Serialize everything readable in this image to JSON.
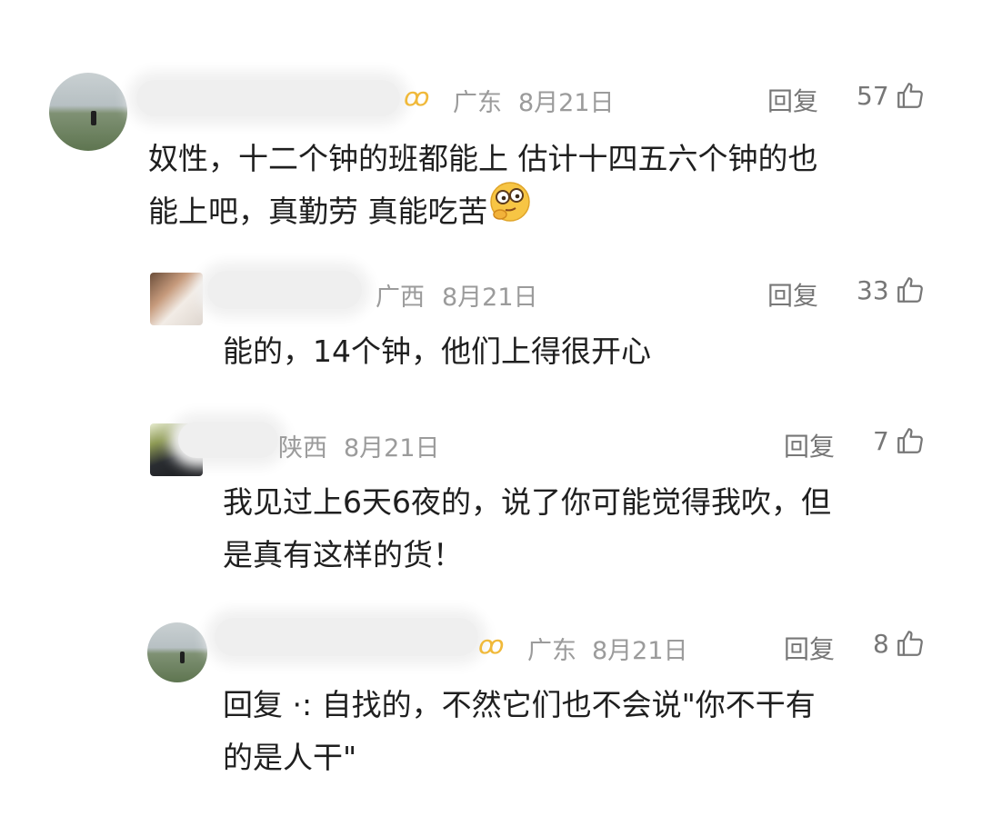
{
  "comments": [
    {
      "region": "广东",
      "date": "8月21日",
      "reply_label": "回复",
      "likes": "57",
      "text_line1": "奴性，十二个钟的班都能上 估计十四五六个钟的也",
      "text_line2": "能上吧，真勤劳 真能吃苦",
      "emoji": "thinking-glasses-emoji"
    },
    {
      "region": "广西",
      "date": "8月21日",
      "reply_label": "回复",
      "likes": "33",
      "text_line1": "能的，14个钟，他们上得很开心"
    },
    {
      "region": "陕西",
      "date": "8月21日",
      "reply_label": "回复",
      "likes": "7",
      "text_line1": "我见过上6天6夜的，说了你可能觉得我吹，但",
      "text_line2": "是真有这样的货！"
    },
    {
      "region": "广东",
      "date": "8月21日",
      "reply_label": "回复",
      "likes": "8",
      "text_line1": "回复 ·: 自找的，不然它们也不会说\"你不干有",
      "text_line2": "的是人干\""
    }
  ],
  "colors": {
    "meta": "#9b9b9b",
    "text": "#1f1f1f",
    "badge": "#f0b93a"
  }
}
